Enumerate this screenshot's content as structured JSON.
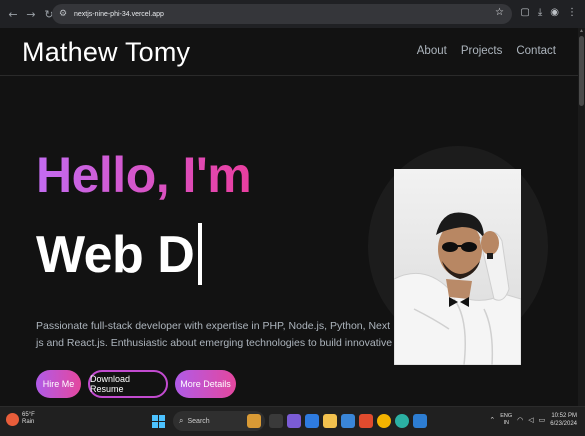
{
  "browser": {
    "url": "nextjs-nine-phi-34.vercel.app"
  },
  "header": {
    "brand": "Mathew Tomy",
    "nav": [
      "About",
      "Projects",
      "Contact"
    ]
  },
  "hero": {
    "greeting": "Hello, I'm",
    "typed_text": "Web D",
    "description": "Passionate full-stack developer with expertise in PHP, Node.js, Python, Next js and React.js. Enthusiastic about emerging technologies to build innovative",
    "buttons": {
      "hire": "Hire Me",
      "resume": "Download Resume",
      "more": "More Details"
    }
  },
  "taskbar": {
    "weather_temp": "65°F",
    "weather_cond": "Rain",
    "search_placeholder": "Search",
    "lang_1": "ENG",
    "lang_2": "IN",
    "time": "10:52 PM",
    "date": "6/23/2024"
  },
  "colors": {
    "accent_start": "#c36cf1",
    "accent_end": "#ea3e9f",
    "background": "#121212"
  }
}
